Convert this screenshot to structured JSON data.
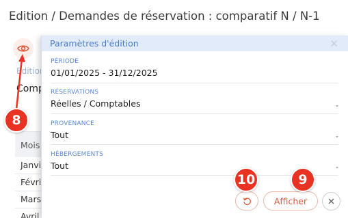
{
  "page": {
    "title": "Edition / Demandes de réservation : comparatif N / N-1"
  },
  "background": {
    "edition_label": "Edition",
    "comp_label": "Comp",
    "table_header": "Mois",
    "rows": [
      "Janvi",
      "Févri",
      "Mars",
      "Avril"
    ]
  },
  "panel": {
    "title": "Paramètres d'édition",
    "fields": [
      {
        "label": "PÉRIODE",
        "value": "01/01/2025 - 31/12/2025",
        "has_dropdown": false
      },
      {
        "label": "RÉSERVATIONS",
        "value": "Réelles / Comptables",
        "has_dropdown": true
      },
      {
        "label": "PROVENANCE",
        "value": "Tout",
        "has_dropdown": true
      },
      {
        "label": "HÉBERGEMENTS",
        "value": "Tout",
        "has_dropdown": true
      }
    ],
    "buttons": {
      "afficher": "Afficher"
    }
  },
  "annotations": {
    "eye": "8",
    "afficher": "9",
    "reset": "10"
  },
  "colors": {
    "accent": "#d9593a",
    "callout": "#e83224",
    "header_bg": "#e2ebf9",
    "label_blue": "#5b8ad6"
  }
}
